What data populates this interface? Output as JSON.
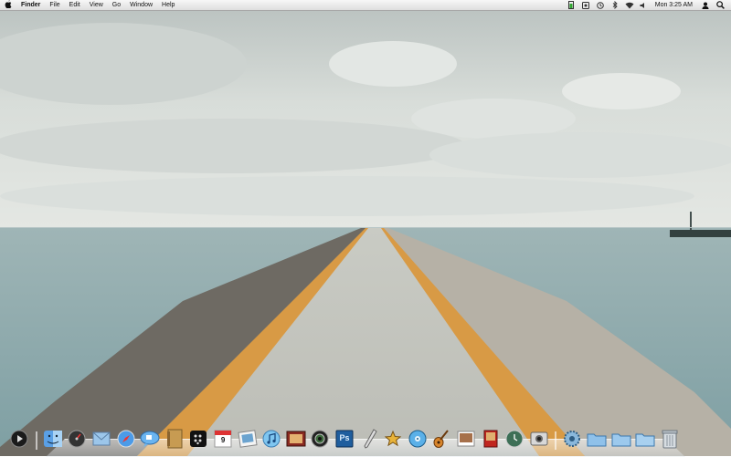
{
  "menubar": {
    "apple_icon": "apple-icon",
    "app_name": "Finder",
    "menus": [
      "File",
      "Edit",
      "View",
      "Go",
      "Window",
      "Help"
    ],
    "extras_icons": [
      "battery-icon",
      "app-status-icon",
      "time-machine-icon",
      "bluetooth-icon",
      "wifi-icon",
      "volume-icon"
    ],
    "clock": "Mon 3:25 AM",
    "user_icon": "user-icon",
    "spotlight_icon": "spotlight-icon"
  },
  "dock": {
    "items": [
      "quicktime-icon",
      "finder-icon",
      "dashboard-icon",
      "mail-icon",
      "safari-icon",
      "ichat-icon",
      "address-book-icon",
      "blackberry-icon",
      "ical-icon",
      "iphoto-icon",
      "itunes-icon",
      "photo-booth-icon",
      "aperture-icon",
      "photoshop-icon",
      "pen-tool-icon",
      "star-app-icon",
      "dvd-player-icon",
      "guitar-icon",
      "preview-icon",
      "photo-stack-icon",
      "time-machine-dock-icon",
      "screenshot-icon",
      "system-preferences-icon",
      "applications-stack-icon",
      "documents-stack-icon",
      "downloads-stack-icon",
      "trash-icon"
    ],
    "labels": {
      "ical_day": "9",
      "photoshop": "Ps"
    }
  }
}
